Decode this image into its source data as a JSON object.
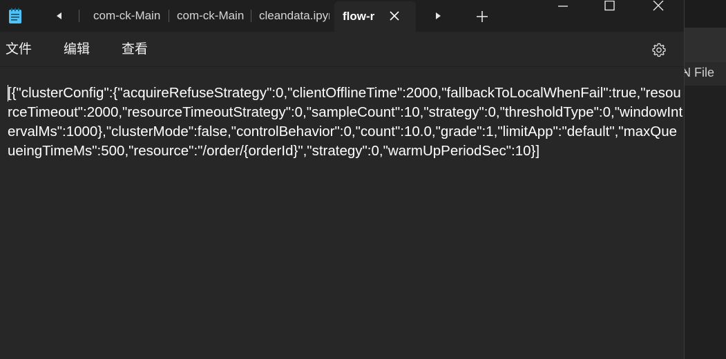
{
  "tabs": [
    {
      "label": "com-ck-Main"
    },
    {
      "label": "com-ck-Main"
    },
    {
      "label": "cleandata.ipynb"
    },
    {
      "label": "flow-rules",
      "active": true
    }
  ],
  "menu": {
    "file": "文件",
    "edit": "编辑",
    "view": "查看"
  },
  "editor": {
    "content": "[{\"clusterConfig\":{\"acquireRefuseStrategy\":0,\"clientOfflineTime\":2000,\"fallbackToLocalWhenFail\":true,\"resourceTimeout\":2000,\"resourceTimeoutStrategy\":0,\"sampleCount\":10,\"strategy\":0,\"thresholdType\":0,\"windowIntervalMs\":1000},\"clusterMode\":false,\"controlBehavior\":0,\"count\":10.0,\"grade\":1,\"limitApp\":\"default\",\"maxQueueingTimeMs\":500,\"resource\":\"/order/{orderId}\",\"strategy\":0,\"warmUpPeriodSec\":10}]"
  },
  "side_panel": {
    "partial_label": "N File"
  },
  "icons": {
    "app": "notepad-icon",
    "nav_left": "scroll-left-icon",
    "nav_right": "scroll-right-icon",
    "new_tab": "plus-icon",
    "close_tab": "close-icon",
    "minimize": "minimize-icon",
    "maximize": "maximize-icon",
    "close_window": "close-window-icon",
    "settings": "gear-icon"
  },
  "colors": {
    "background": "#272727",
    "titlebar": "#1f1f1f",
    "text": "#ffffff",
    "app_icon": "#4fc3f7"
  }
}
